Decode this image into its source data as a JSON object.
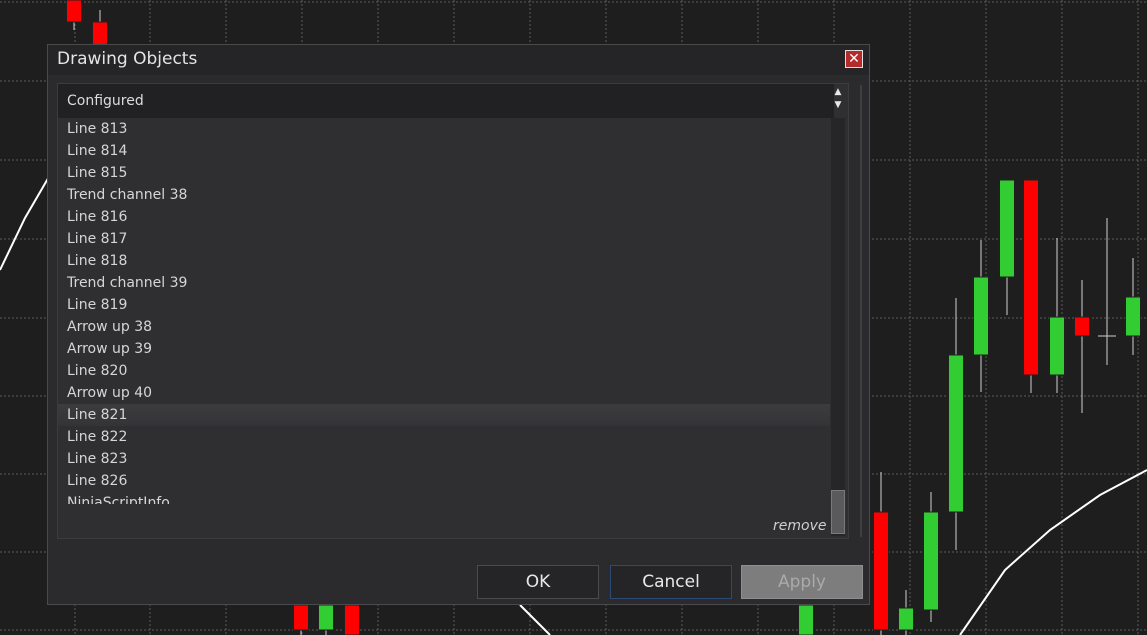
{
  "colors": {
    "chart_background": "#1e1e1e",
    "grid": "#5a5a5a",
    "candle_up": "#32cd32",
    "candle_down": "#ff0000",
    "indicator_line": "#ffffff",
    "dialog_background": "#2b2b2d",
    "close_button": "#b52a2a",
    "apply_disabled": "#7d7d7d"
  },
  "dialog": {
    "title": "Drawing Objects",
    "close_icon": "close-icon",
    "panel": {
      "header": "Configured",
      "sort_icon": "up-down-arrows-icon",
      "items": [
        {
          "label": "Line 813"
        },
        {
          "label": "Line 814"
        },
        {
          "label": "Line 815"
        },
        {
          "label": "Trend channel 38"
        },
        {
          "label": "Line 816"
        },
        {
          "label": "Line 817"
        },
        {
          "label": "Line 818"
        },
        {
          "label": "Trend channel 39"
        },
        {
          "label": "Line 819"
        },
        {
          "label": "Arrow up 38"
        },
        {
          "label": "Arrow up 39"
        },
        {
          "label": "Line 820"
        },
        {
          "label": "Arrow up 40"
        },
        {
          "label": "Line 821",
          "selected": true
        },
        {
          "label": "Line 822"
        },
        {
          "label": "Line 823"
        },
        {
          "label": "Line 826"
        },
        {
          "label": "NinjaScriptInfo"
        }
      ],
      "remove_label": "remove"
    },
    "buttons": {
      "ok": "OK",
      "cancel": "Cancel",
      "apply": "Apply"
    }
  }
}
